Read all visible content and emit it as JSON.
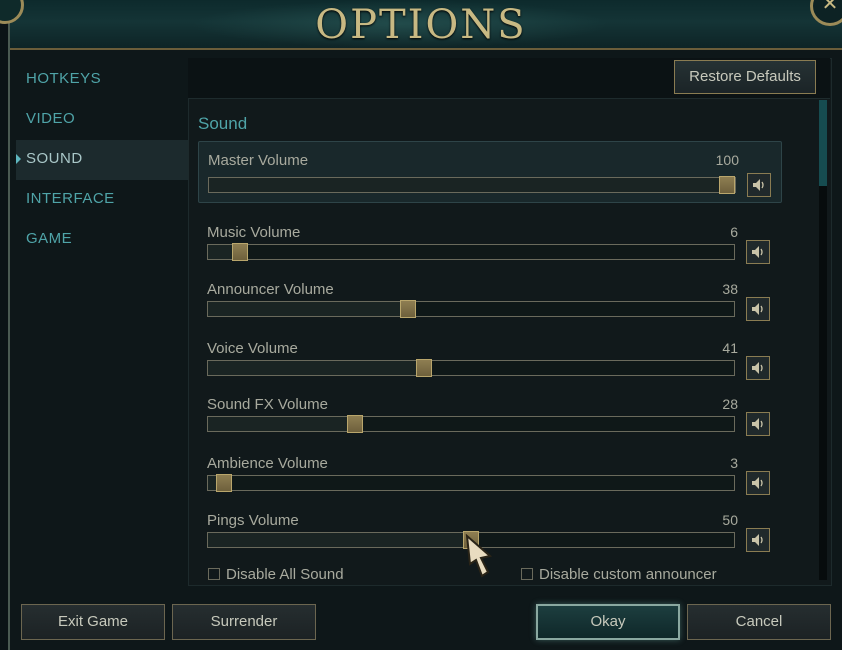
{
  "window": {
    "title": "OPTIONS",
    "close_glyph": "✕"
  },
  "nav": {
    "items": [
      {
        "label": "HOTKEYS",
        "active": false
      },
      {
        "label": "VIDEO",
        "active": false
      },
      {
        "label": "SOUND",
        "active": true
      },
      {
        "label": "INTERFACE",
        "active": false
      },
      {
        "label": "GAME",
        "active": false
      }
    ]
  },
  "toolbar": {
    "restore_label": "Restore Defaults"
  },
  "sound": {
    "section_title": "Sound",
    "sliders": [
      {
        "label": "Master Volume",
        "value": "100",
        "fraction": 1.0
      },
      {
        "label": "Music Volume",
        "value": "6",
        "fraction": 0.06
      },
      {
        "label": "Announcer Volume",
        "value": "38",
        "fraction": 0.38
      },
      {
        "label": "Voice Volume",
        "value": "41",
        "fraction": 0.41
      },
      {
        "label": "Sound FX Volume",
        "value": "28",
        "fraction": 0.28
      },
      {
        "label": "Ambience Volume",
        "value": "3",
        "fraction": 0.03
      },
      {
        "label": "Pings Volume",
        "value": "50",
        "fraction": 0.5
      }
    ],
    "disable_all_label": "Disable All Sound",
    "disable_all_checked": false,
    "disable_announcer_label": "Disable custom announcer",
    "disable_announcer_checked": false
  },
  "footer": {
    "exit_label": "Exit Game",
    "surrender_label": "Surrender",
    "okay_label": "Okay",
    "cancel_label": "Cancel"
  },
  "colors": {
    "accent_teal": "#4fa4a8",
    "gold": "#c8b983",
    "panel_bg": "#11191b"
  },
  "icons": {
    "mute": "speaker-icon",
    "close": "close-icon",
    "cursor": "mouse-pointer-icon"
  }
}
